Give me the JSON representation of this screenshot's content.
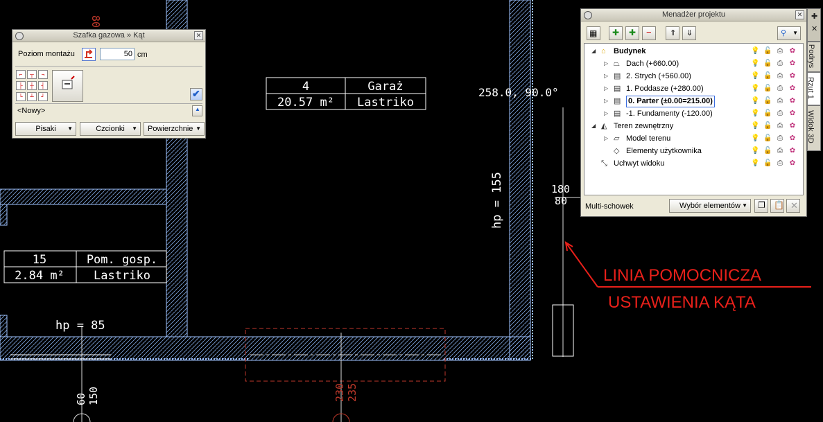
{
  "drawing": {
    "room_large": {
      "number": "4",
      "name": "Garaż",
      "area": "20.57 m²",
      "floor": "Lastriko"
    },
    "room_small": {
      "number": "15",
      "name": "Pom. gosp.",
      "area": "2.84 m²",
      "floor": "Lastriko"
    },
    "hp_85": "hp = 85",
    "hp_155": "hp = 155",
    "angle_label": "258.0, 90.0°",
    "dim_180": "180",
    "dim_80": "80",
    "dim_50": "60",
    "dim_150": "150",
    "dim_230": "230",
    "dim_235": "235",
    "dim_top": "80",
    "annotation_line1": "LINIA POMOCNICZA",
    "annotation_line2": "USTAWIENIA KĄTA",
    "colors": {
      "wall": "#9fc3ff",
      "annotation": "#e8201a",
      "dashed": "#c0392b"
    }
  },
  "gas_panel": {
    "title": "Szafka gazowa » Kąt",
    "mount_label": "Poziom montażu",
    "mount_value": "50",
    "unit": "cm",
    "preset": "<Nowy>",
    "pens_button": "Pisaki",
    "fonts_button": "Czcionki",
    "surfaces_button": "Powierzchnie"
  },
  "project_manager": {
    "title": "Menadżer projektu",
    "tree": [
      {
        "label": "Budynek",
        "level": 0,
        "bold": true,
        "expand": "◢",
        "icon": "building-icon"
      },
      {
        "label": "Dach (+660.00)",
        "level": 1,
        "expand": "▷",
        "icon": "roof-icon"
      },
      {
        "label": "2. Strych (+560.00)",
        "level": 1,
        "expand": "▷",
        "icon": "storey-icon"
      },
      {
        "label": "1. Poddasze (+280.00)",
        "level": 1,
        "expand": "▷",
        "icon": "storey-icon"
      },
      {
        "label": "0. Parter (±0.00=215.00)",
        "level": 1,
        "expand": "▷",
        "icon": "storey-icon",
        "selected": true
      },
      {
        "label": "-1. Fundamenty (-120.00)",
        "level": 1,
        "expand": "▷",
        "icon": "storey-icon"
      },
      {
        "label": "Teren zewnętrzny",
        "level": 0,
        "expand": "◢",
        "icon": "terrain-icon"
      },
      {
        "label": "Model terenu",
        "level": 1,
        "expand": "▷",
        "icon": "terrain-model-icon"
      },
      {
        "label": "Elementy użytkownika",
        "level": 1,
        "expand": "",
        "icon": "user-elements-icon"
      },
      {
        "label": "Uchwyt widoku",
        "level": 0,
        "expand": "",
        "icon": "view-handle-icon"
      }
    ],
    "multi_clipboard_label": "Multi-schowek",
    "selection_button": "Wybór elementów",
    "side_tabs": [
      "Podrys",
      "Rzut 1",
      "Widok 3D"
    ]
  }
}
